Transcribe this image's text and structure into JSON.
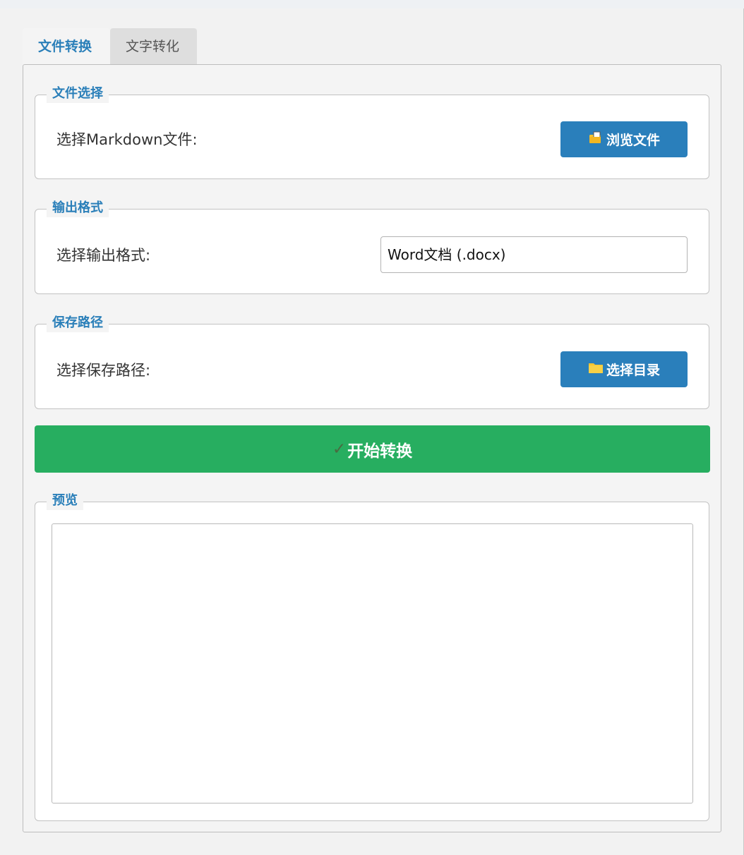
{
  "tabs": [
    {
      "label": "文件转换",
      "active": true
    },
    {
      "label": "文字转化",
      "active": false
    }
  ],
  "file_select": {
    "title": "文件选择",
    "label": "选择Markdown文件:",
    "button_icon": "file-browse-icon",
    "button_label": "浏览文件"
  },
  "output_format": {
    "title": "输出格式",
    "label": "选择输出格式:",
    "selected": "Word文档 (.docx)"
  },
  "save_path": {
    "title": "保存路径",
    "label": "选择保存路径:",
    "button_icon": "folder-icon",
    "button_label": "选择目录"
  },
  "convert": {
    "icon": "checkmark-icon",
    "label": "开始转换"
  },
  "preview": {
    "title": "预览",
    "content": ""
  },
  "colors": {
    "accent": "#2a7fb9",
    "convert_green": "#27ae60"
  }
}
